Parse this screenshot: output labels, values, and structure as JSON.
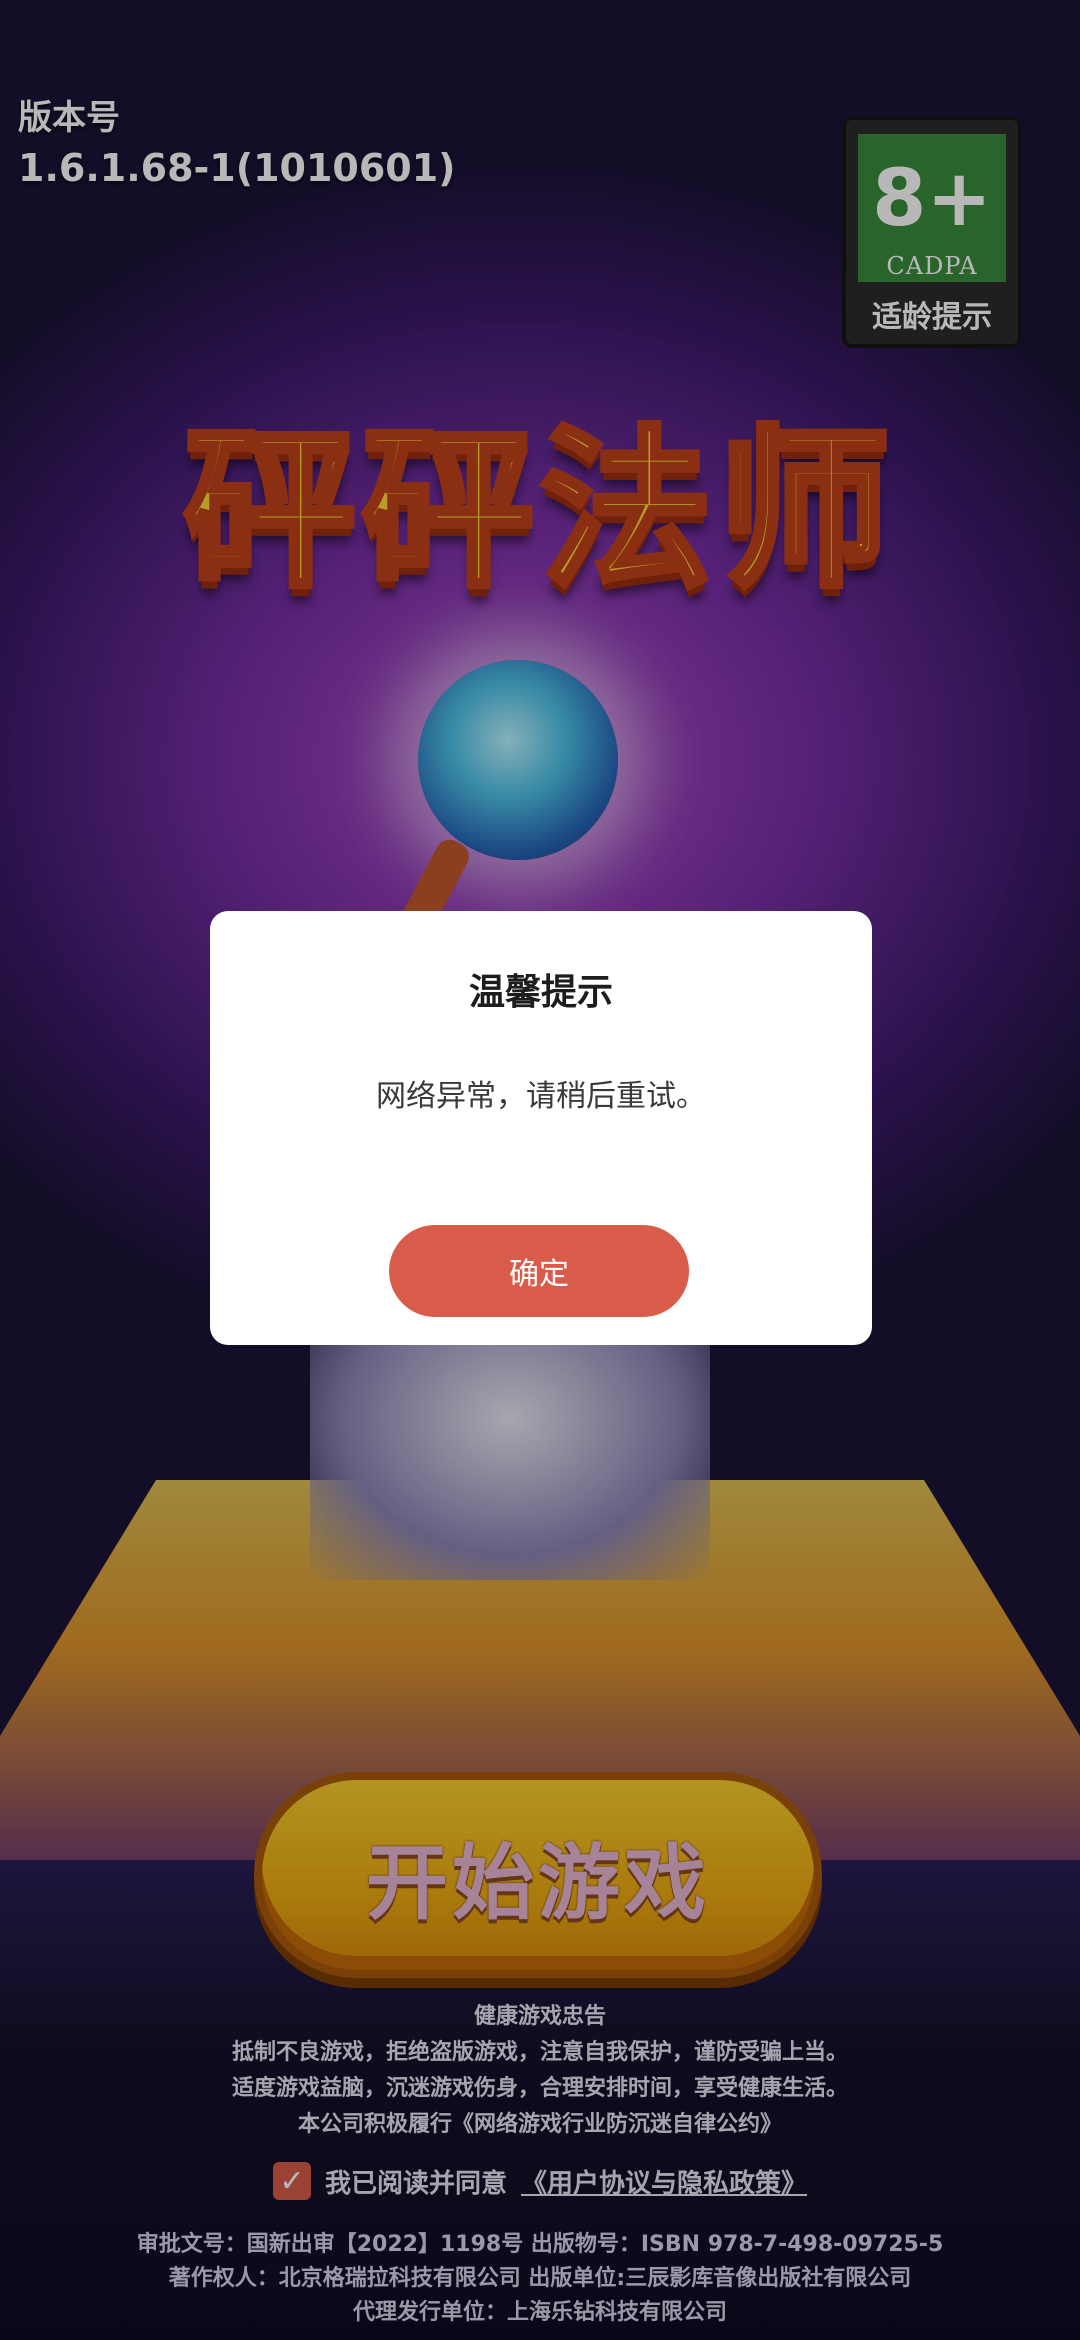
{
  "version": {
    "label": "版本号",
    "number": "1.6.1.68-1(1010601)"
  },
  "age_rating": {
    "age": "8+",
    "org": "CADPA",
    "caption": "适龄提示",
    "accent": "#3a8d3c"
  },
  "game": {
    "title": "砰砰法师"
  },
  "dialog": {
    "title": "温馨提示",
    "message": "网络异常，请稍后重试。",
    "confirm_label": "确定",
    "accent": "#d95c4a"
  },
  "start_button": {
    "label": "开始游戏"
  },
  "health_notice": {
    "title": "健康游戏忠告",
    "lines": [
      "抵制不良游戏，拒绝盗版游戏，注意自我保护，谨防受骗上当。",
      "适度游戏益脑，沉迷游戏伤身，合理安排时间，享受健康生活。",
      "本公司积极履行《网络游戏行业防沉迷自律公约》"
    ]
  },
  "agreement": {
    "checked": true,
    "text": "我已阅读并同意",
    "link": "《用户协议与隐私政策》"
  },
  "legal": {
    "lines": [
      "审批文号：国新出审【2022】1198号 出版物号：ISBN 978-7-498-09725-5",
      "著作权人：北京格瑞拉科技有限公司 出版单位:三辰影库音像出版社有限公司",
      "代理发行单位：上海乐钻科技有限公司"
    ]
  }
}
